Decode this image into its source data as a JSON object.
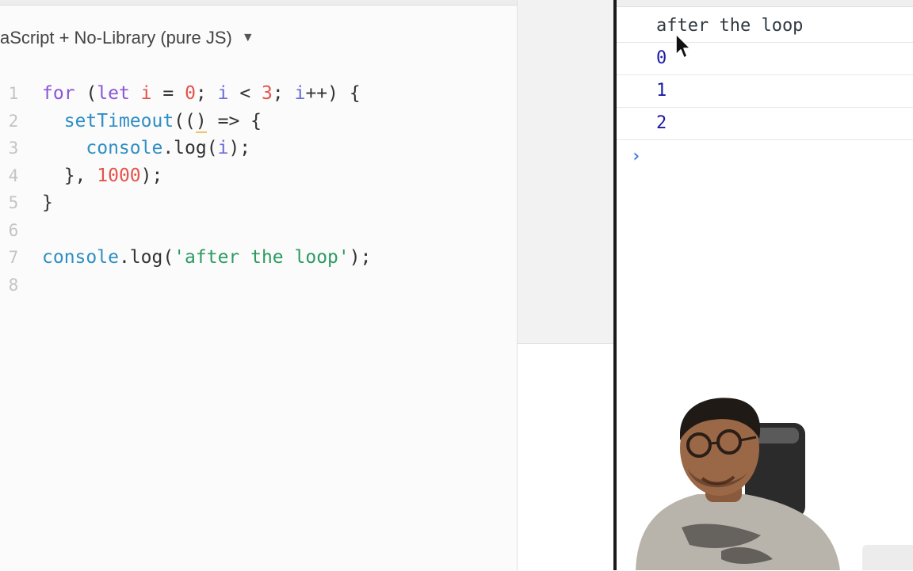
{
  "editor": {
    "language_label": "aScript + No-Library (pure JS)",
    "language_caret": "▼",
    "lines": [
      {
        "num": "1",
        "tokens": [
          {
            "t": "for",
            "c": "kw"
          },
          {
            "t": " (",
            "c": "pl"
          },
          {
            "t": "let",
            "c": "kw"
          },
          {
            "t": " ",
            "c": "pl"
          },
          {
            "t": "i",
            "c": "num"
          },
          {
            "t": " = ",
            "c": "pl"
          },
          {
            "t": "0",
            "c": "num"
          },
          {
            "t": "; ",
            "c": "pl"
          },
          {
            "t": "i",
            "c": "var"
          },
          {
            "t": " < ",
            "c": "pl"
          },
          {
            "t": "3",
            "c": "num"
          },
          {
            "t": "; ",
            "c": "pl"
          },
          {
            "t": "i",
            "c": "var"
          },
          {
            "t": "++) {",
            "c": "pl"
          }
        ]
      },
      {
        "num": "2",
        "tokens": [
          {
            "t": "  ",
            "c": "pl"
          },
          {
            "t": "setTimeout",
            "c": "fn"
          },
          {
            "t": "((",
            "c": "pl"
          },
          {
            "t": ")",
            "c": "pl underline-mark"
          },
          {
            "t": " => {",
            "c": "pl"
          }
        ]
      },
      {
        "num": "3",
        "tokens": [
          {
            "t": "    ",
            "c": "pl"
          },
          {
            "t": "console",
            "c": "fn"
          },
          {
            "t": ".log(",
            "c": "pl"
          },
          {
            "t": "i",
            "c": "var"
          },
          {
            "t": ");",
            "c": "pl"
          }
        ]
      },
      {
        "num": "4",
        "tokens": [
          {
            "t": "  }, ",
            "c": "pl"
          },
          {
            "t": "1000",
            "c": "num"
          },
          {
            "t": ");",
            "c": "pl"
          }
        ]
      },
      {
        "num": "5",
        "tokens": [
          {
            "t": "}",
            "c": "pl"
          }
        ]
      },
      {
        "num": "6",
        "tokens": []
      },
      {
        "num": "7",
        "tokens": [
          {
            "t": "console",
            "c": "fn"
          },
          {
            "t": ".log(",
            "c": "pl"
          },
          {
            "t": "'after the loop'",
            "c": "str"
          },
          {
            "t": ");",
            "c": "pl"
          }
        ]
      },
      {
        "num": "8",
        "tokens": []
      }
    ]
  },
  "console": {
    "rows": [
      {
        "text": "after the loop",
        "kind": "text"
      },
      {
        "text": "0",
        "kind": "num"
      },
      {
        "text": "1",
        "kind": "num"
      },
      {
        "text": "2",
        "kind": "num"
      }
    ],
    "prompt_glyph": "›"
  },
  "icons": {
    "cursor": "mouse-pointer-icon",
    "caret": "triangle-down-icon"
  }
}
